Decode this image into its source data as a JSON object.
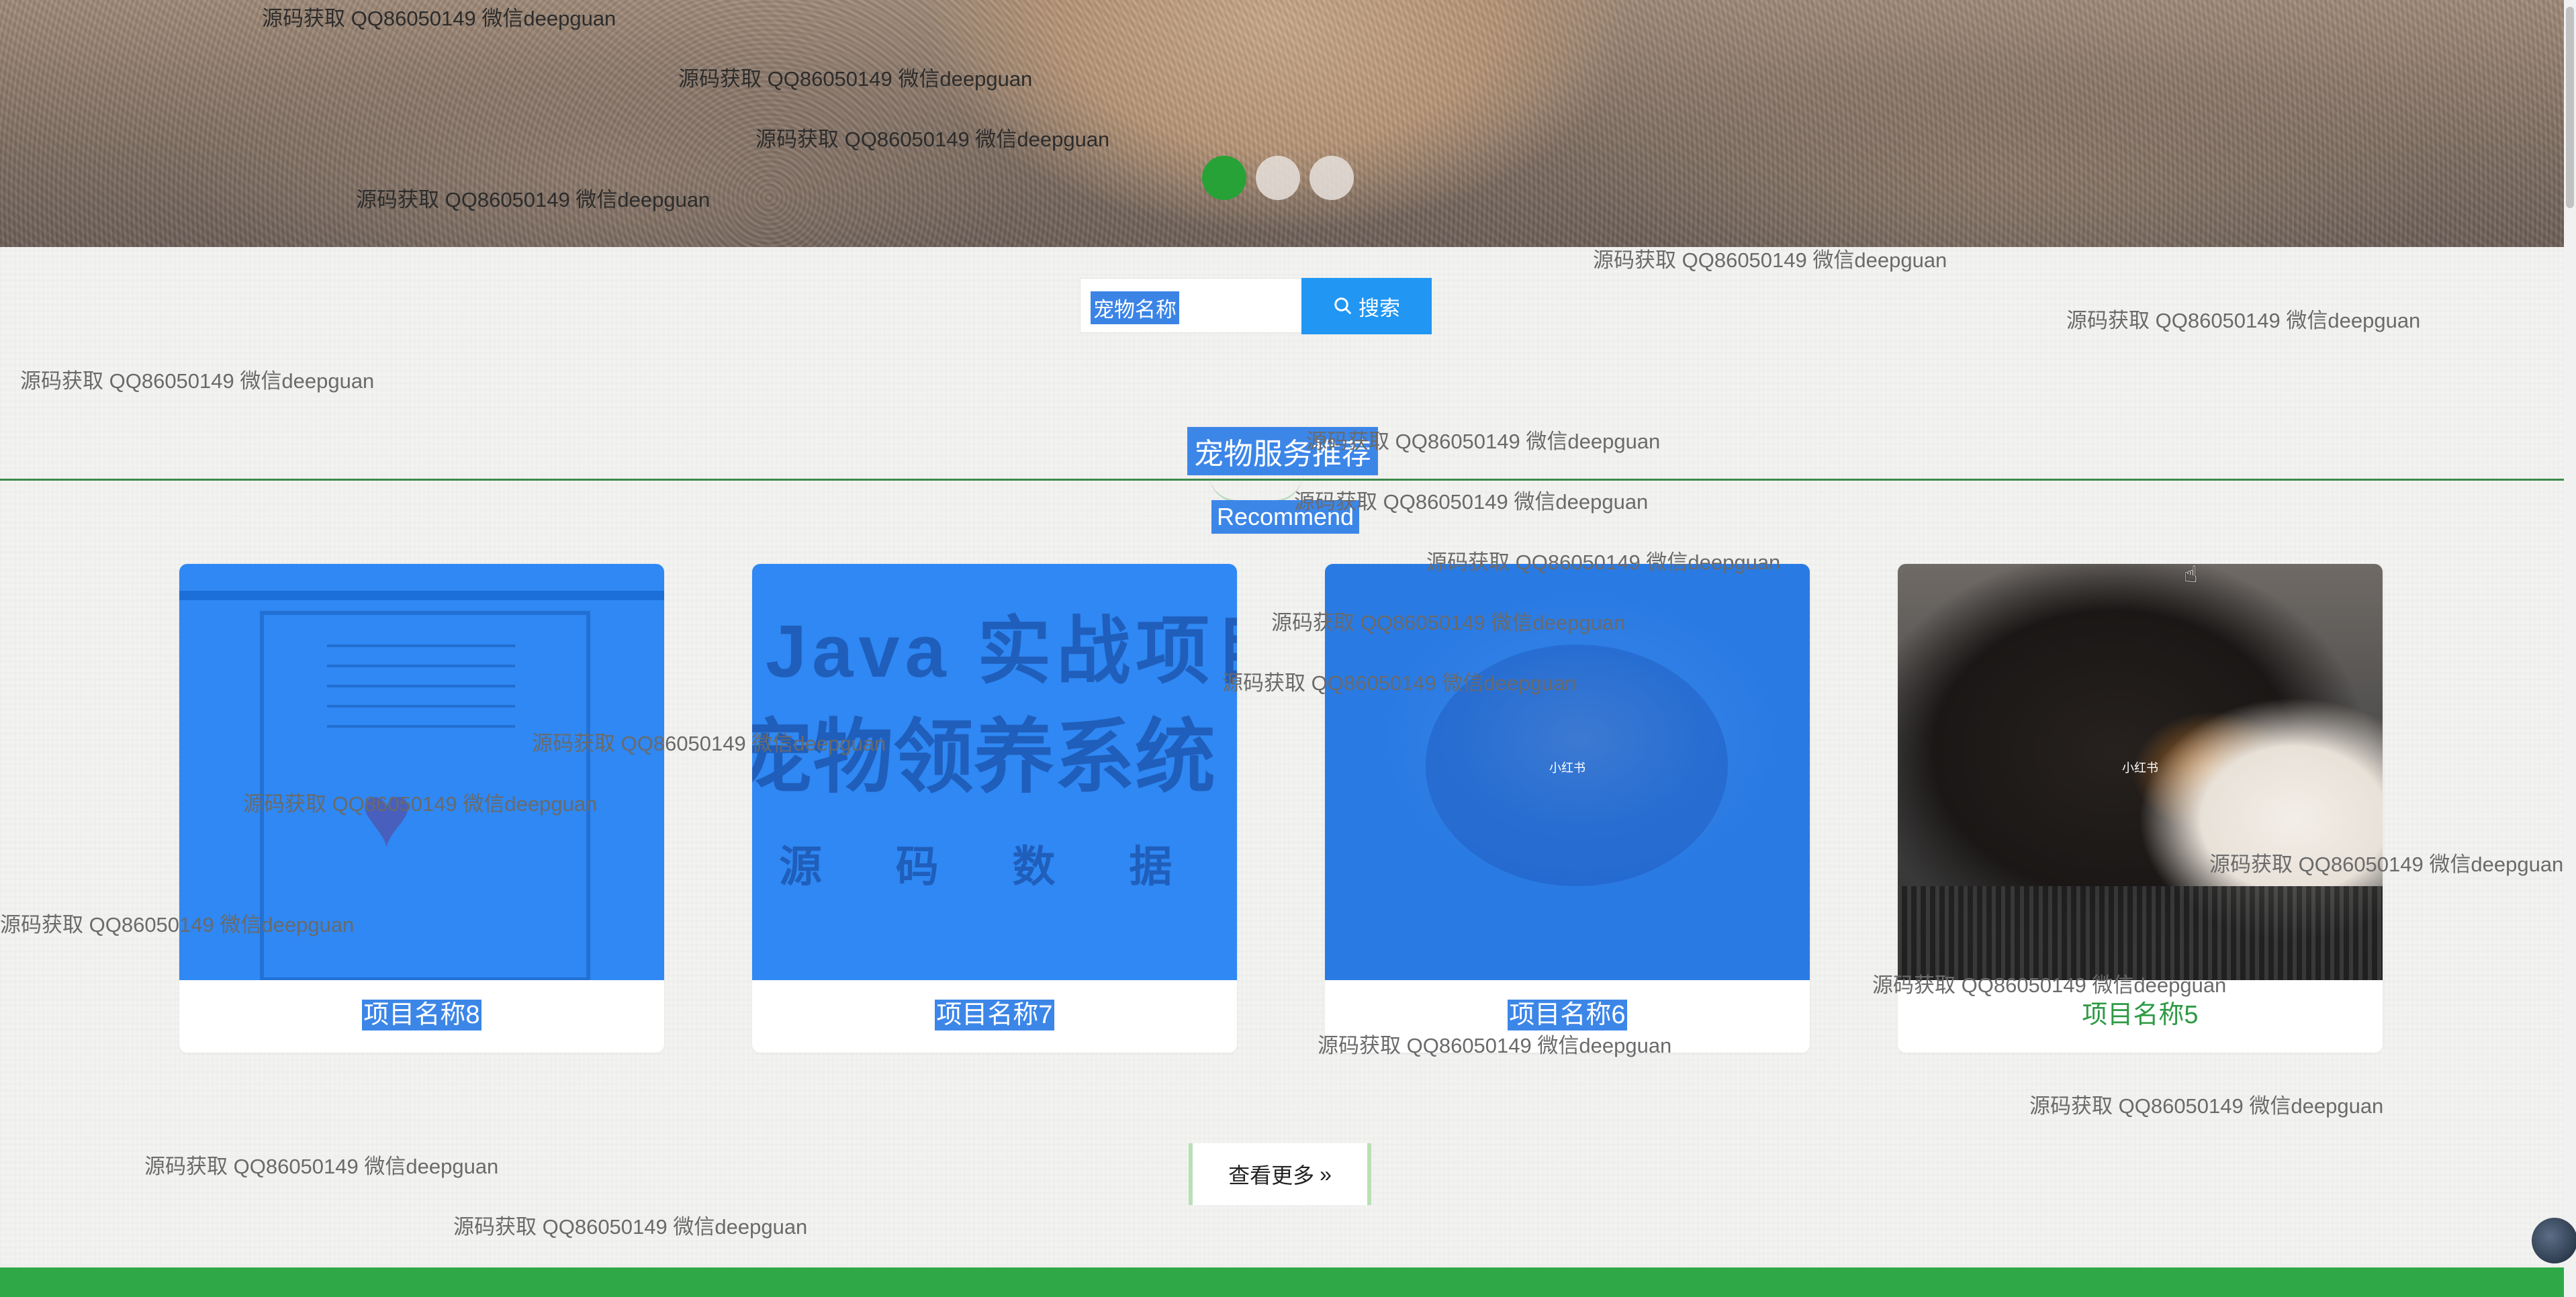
{
  "search": {
    "placeholder": "宠物名称",
    "button_label": "搜索",
    "icon": "search-icon"
  },
  "section": {
    "title": "宠物服务推荐",
    "subtitle": "Recommend"
  },
  "cards": [
    {
      "name": "项目名称8"
    },
    {
      "name": "项目名称7",
      "image_text": [
        "Java 实战项目",
        "宠物领养系统",
        "源 码 数 据 库 视 频"
      ]
    },
    {
      "name": "项目名称6",
      "image_badge": "小红书"
    },
    {
      "name": "项目名称5",
      "image_badge": "小红书"
    }
  ],
  "more_button": {
    "label": "查看更多",
    "icon": "double-chevron-right-icon"
  },
  "watermark": "源码获取 QQ86050149 微信deepguan",
  "colors": {
    "accent_green": "#2fa948",
    "search_blue": "#2196f3",
    "selection_blue": "#3c86e8",
    "name_green": "#2e9a44"
  }
}
